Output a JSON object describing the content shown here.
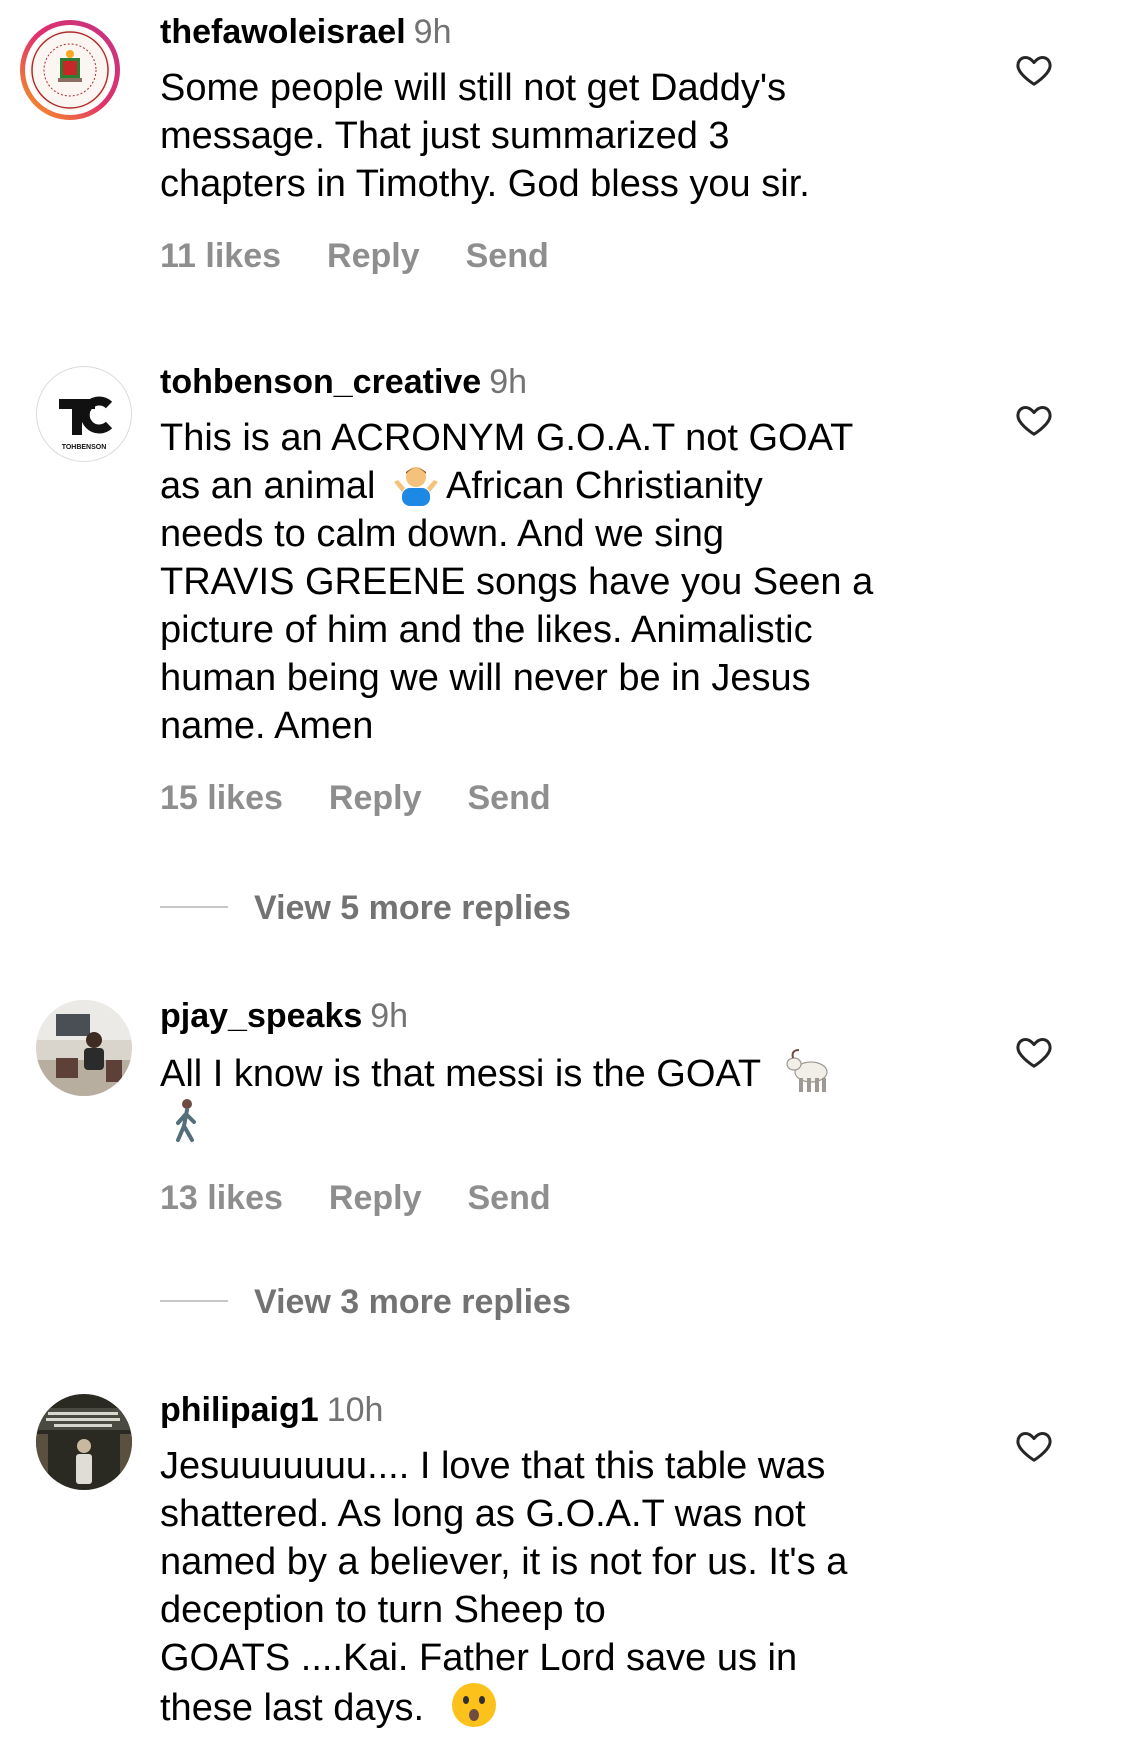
{
  "comments": [
    {
      "username": "thefawoleisrael",
      "time": "9h",
      "lines": [
        "Some people will still not get Daddy's",
        "message. That just summarized 3",
        "chapters in Timothy.  God bless you sir."
      ],
      "likes": "11 likes",
      "reply": "Reply",
      "send": "Send",
      "avatar_icon": "seal-avatar-icon"
    },
    {
      "username": "tohbenson_creative",
      "time": "9h",
      "lines": [
        "This is an ACRONYM G.O.A.T not GOAT",
        "as an animal",
        "African Christianity",
        "needs to calm down. And we sing",
        "TRAVIS GREENE songs have you Seen a",
        "picture of him and the likes. Animalistic",
        "human being we will never be in Jesus",
        "name. Amen"
      ],
      "likes": "15 likes",
      "reply": "Reply",
      "send": "Send",
      "view_more": "View 5 more replies",
      "avatar_text": "TOHBENSON"
    },
    {
      "username": "pjay_speaks",
      "time": "9h",
      "lines": [
        "All I know is that messi is the GOAT"
      ],
      "likes": "13 likes",
      "reply": "Reply",
      "send": "Send",
      "view_more": "View 3 more replies"
    },
    {
      "username": "philipaig1",
      "time": "10h",
      "lines": [
        "Jesuuuuuuu.... I love that this table was",
        "shattered. As long as G.O.A.T was not",
        "named by a believer, it is not for us. It's a",
        "deception to turn Sheep to",
        "GOATS ....Kai. Father Lord save us in",
        "these last days."
      ]
    }
  ],
  "icons": {
    "heart": "heart-outline-icon",
    "shrug": "person-shrugging-emoji",
    "goat": "goat-emoji",
    "walk": "person-walking-emoji",
    "hushed": "hushed-face-emoji"
  },
  "colors": {
    "text": "#000000",
    "secondary": "#737373",
    "actions": "#8e8e8e",
    "divider": "#c7c7c7",
    "story_ring_start": "#f9a21b",
    "story_ring_end": "#c13584"
  }
}
